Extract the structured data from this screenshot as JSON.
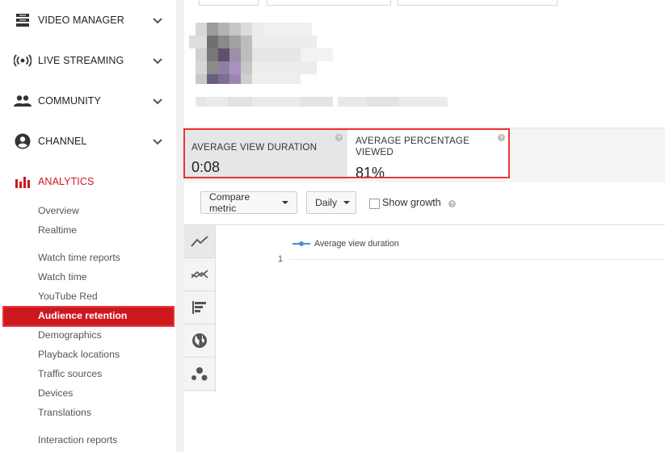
{
  "sidebar": {
    "sections": [
      {
        "label": "VIDEO MANAGER",
        "icon": "video-manager-icon"
      },
      {
        "label": "LIVE STREAMING",
        "icon": "live-streaming-icon"
      },
      {
        "label": "COMMUNITY",
        "icon": "community-icon"
      },
      {
        "label": "CHANNEL",
        "icon": "channel-icon"
      },
      {
        "label": "ANALYTICS",
        "icon": "analytics-icon"
      }
    ],
    "analytics_items": {
      "overview": "Overview",
      "realtime": "Realtime",
      "watch_time_reports": "Watch time reports",
      "watch_time": "Watch time",
      "youtube_red": "YouTube Red",
      "audience_retention": "Audience retention",
      "demographics": "Demographics",
      "playback_locations": "Playback locations",
      "traffic_sources": "Traffic sources",
      "devices": "Devices",
      "translations": "Translations",
      "interaction_reports": "Interaction reports"
    },
    "active_color": "#cc181e"
  },
  "metrics": {
    "avg_view_duration": {
      "label": "AVERAGE VIEW DURATION",
      "value": "0:08"
    },
    "avg_percentage_viewed": {
      "label_line1": "AVERAGE PERCENTAGE",
      "label_line2": "VIEWED",
      "value": "81%"
    }
  },
  "toolbar": {
    "compare_metric": "Compare metric",
    "daily": "Daily",
    "show_growth": "Show growth",
    "show_growth_checked": false
  },
  "chart_data": {
    "type": "line",
    "series": [
      {
        "name": "Average view duration",
        "values": []
      }
    ],
    "y_tick_labels": [
      "1"
    ],
    "grid": true,
    "legend_placement": "top-left"
  },
  "chart_tabs": [
    "line-chart-icon",
    "multi-line-chart-icon",
    "bar-chart-icon",
    "globe-icon",
    "bubble-chart-icon"
  ]
}
